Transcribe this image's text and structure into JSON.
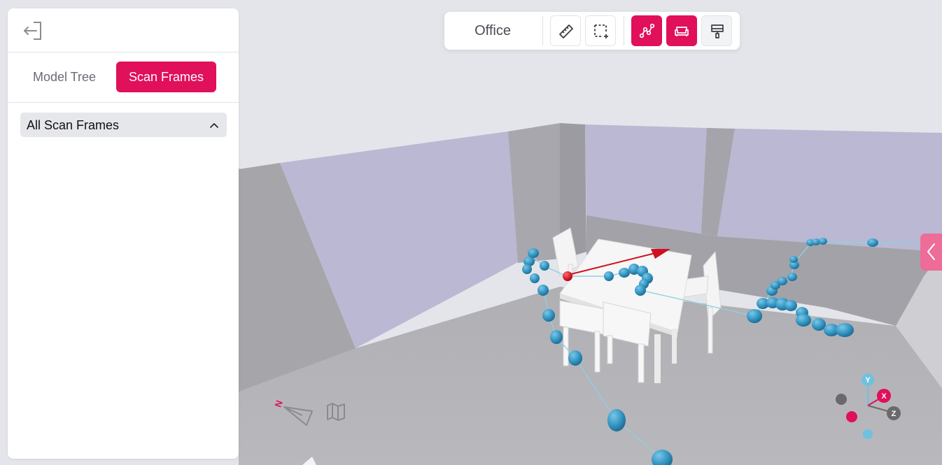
{
  "side_panel": {
    "exit_icon": "exit-icon",
    "tabs": [
      {
        "label": "Model Tree",
        "active": false
      },
      {
        "label": "Scan Frames",
        "active": true
      }
    ],
    "dropdown": {
      "label": "All Scan Frames",
      "icon": "chevron-up-icon"
    }
  },
  "toolbar": {
    "title": "Office",
    "tools": [
      {
        "name": "measure",
        "icon": "ruler-icon",
        "active": false
      },
      {
        "name": "area-select",
        "icon": "selection-add-icon",
        "active": false
      },
      {
        "name": "scan-path",
        "icon": "path-icon",
        "active": true
      },
      {
        "name": "furniture",
        "icon": "sofa-icon",
        "active": true
      },
      {
        "name": "paint",
        "icon": "paint-roller-icon",
        "active": false
      }
    ]
  },
  "viewport": {
    "compass_letter": "N",
    "gizmo_labels": {
      "y": "Y",
      "x": "X",
      "z": "Z"
    },
    "colors": {
      "accent": "#e0105a",
      "scan_point": "#3a9cc8",
      "current_frame": "#d0101e",
      "path_line": "#8fd0e0"
    }
  }
}
